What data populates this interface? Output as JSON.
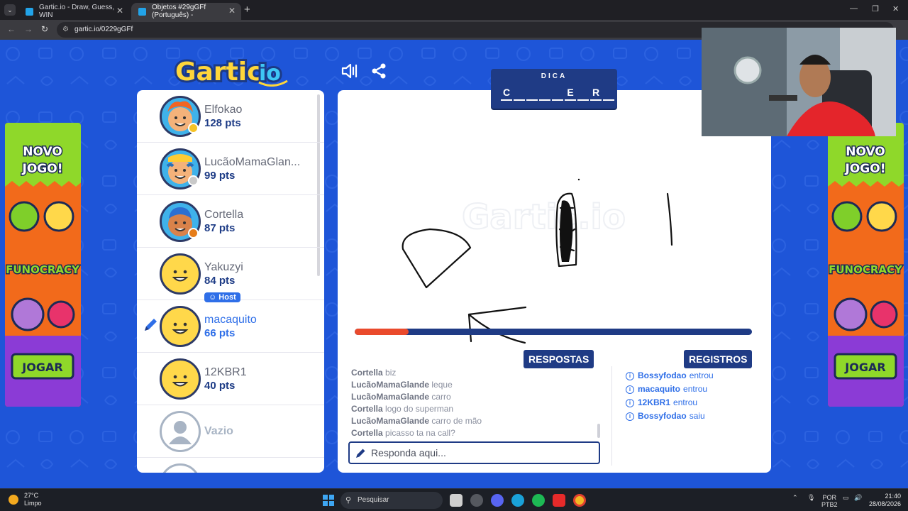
{
  "browser": {
    "tabs": [
      {
        "title": "Gartic.io - Draw, Guess, WIN",
        "active": false
      },
      {
        "title": "Objetos #29gGFf (Português) -",
        "active": true
      }
    ],
    "url": "gartic.io/0229gGFf"
  },
  "game": {
    "logo_text": "Gartic.io",
    "hint": {
      "title": "DICA",
      "letters": [
        "C",
        "",
        "",
        "",
        "",
        "E",
        "",
        "R",
        ""
      ]
    },
    "timer_fraction": 0.135,
    "players": [
      {
        "name": "Elfokao",
        "points": "128 pts",
        "status_color": "#f6c325"
      },
      {
        "name": "LucãoMamaGlan...",
        "points": "99 pts",
        "status_color": "#c9c9c9"
      },
      {
        "name": "Cortella",
        "points": "87 pts",
        "status_color": "#e67d1a"
      },
      {
        "name": "Yakuzyi",
        "points": "84 pts",
        "badge": "Host"
      },
      {
        "name": "macaquito",
        "points": "66 pts",
        "drawing": true
      },
      {
        "name": "12KBR1",
        "points": "40 pts"
      },
      {
        "name": "Vazio",
        "empty": true
      }
    ],
    "answers": {
      "header": "RESPOSTAS",
      "messages": [
        {
          "user": "Cortella",
          "text": "biz"
        },
        {
          "user": "LucãoMamaGlande",
          "text": "leque"
        },
        {
          "user": "LucãoMamaGlande",
          "text": "carro"
        },
        {
          "user": "Cortella",
          "text": "logo do superman"
        },
        {
          "user": "LucãoMamaGlande",
          "text": "carro de mão"
        },
        {
          "user": "Cortella",
          "text": "picasso ta na call?"
        }
      ],
      "placeholder": "Responda aqui..."
    },
    "logs": {
      "header": "REGISTROS",
      "entries": [
        {
          "user": "Bossyfodao",
          "action": "entrou"
        },
        {
          "user": "macaquito",
          "action": "entrou"
        },
        {
          "user": "12KBR1",
          "action": "entrou"
        },
        {
          "user": "Bossyfodao",
          "action": "saiu"
        }
      ]
    }
  },
  "ads": {
    "headline": "NOVO JOGO!",
    "brand": "FUNOCRACY",
    "button": "JOGAR"
  },
  "taskbar": {
    "weather_temp": "27°C",
    "weather_desc": "Limpo",
    "search_placeholder": "Pesquisar",
    "lang": "POR",
    "layout": "PTB2",
    "time": "21:40",
    "date": "28/08/2026"
  },
  "colors": {
    "page_bg": "#1e55d8",
    "navy": "#1f3b85",
    "accent_blue": "#2f6fe8",
    "timer_red": "#ea4a2c"
  }
}
